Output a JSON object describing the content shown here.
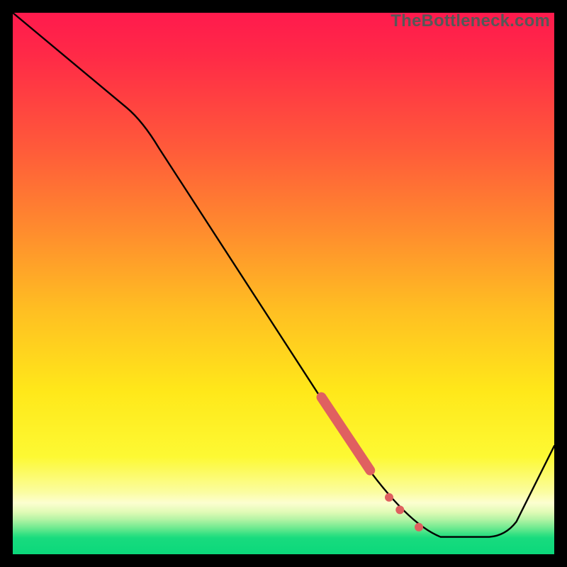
{
  "watermark": "TheBottleneck.com",
  "colors": {
    "frame": "#000000",
    "curve": "#000000",
    "marker": "#e06060",
    "gradient_top": "#ff1a4d",
    "gradient_mid": "#ffe81a",
    "gradient_bottom": "#0bd87b"
  },
  "chart_data": {
    "type": "line",
    "title": "",
    "xlabel": "",
    "ylabel": "",
    "xlim": [
      0,
      100
    ],
    "ylim": [
      0,
      100
    ],
    "series": [
      {
        "name": "bottleneck-curve",
        "x": [
          0,
          22,
          60,
          70,
          75,
          78,
          88,
          100
        ],
        "y": [
          100,
          82,
          24,
          10,
          5,
          3,
          3,
          20
        ]
      }
    ],
    "highlight_segment": {
      "name": "highlighted-range",
      "start": {
        "x": 57,
        "y": 29
      },
      "end": {
        "x": 66,
        "y": 15.5
      }
    },
    "highlight_points": [
      {
        "x": 69.5,
        "y": 10.5
      },
      {
        "x": 71.5,
        "y": 8.2
      },
      {
        "x": 75.0,
        "y": 5.0
      }
    ]
  }
}
